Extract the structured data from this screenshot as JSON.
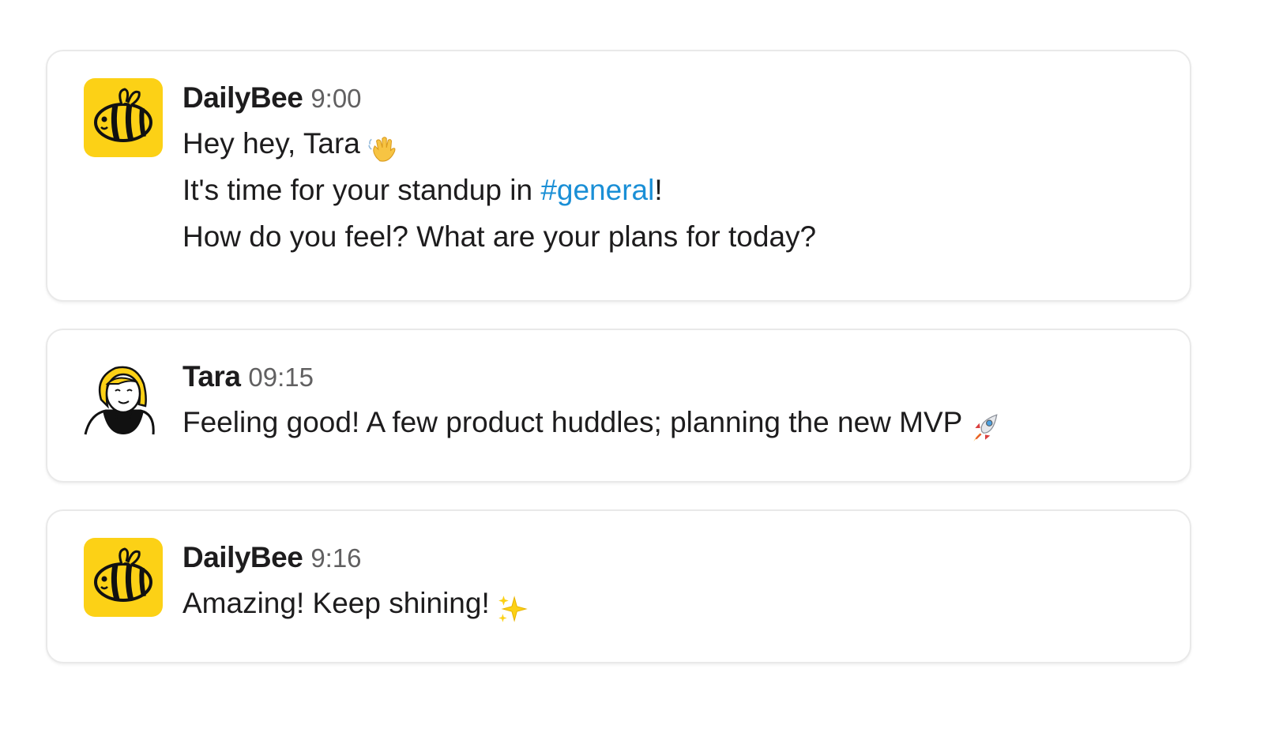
{
  "messages": [
    {
      "author": "DailyBee",
      "time": "9:00",
      "avatar_icon": "bee-icon",
      "lines": [
        {
          "text": "Hey hey, Tara",
          "emoji": "waving-hand-icon"
        },
        {
          "before": "It's time for your standup in ",
          "link": "#general",
          "after": "!"
        },
        {
          "text": "How do you feel? What are your plans for today?"
        }
      ]
    },
    {
      "author": "Tara",
      "time": "09:15",
      "avatar_icon": "tara-avatar-icon",
      "lines": [
        {
          "text": "Feeling good! A few product huddles; planning the new MVP",
          "emoji": "rocket-icon"
        }
      ]
    },
    {
      "author": "DailyBee",
      "time": "9:16",
      "avatar_icon": "bee-icon",
      "lines": [
        {
          "text": "Amazing! Keep shining!",
          "emoji": "sparkles-icon"
        }
      ]
    }
  ],
  "colors": {
    "bee_avatar_bg": "#fcd116",
    "link": "#1a8fd6",
    "timestamp": "#616061",
    "card_border": "#e9e9e9"
  }
}
